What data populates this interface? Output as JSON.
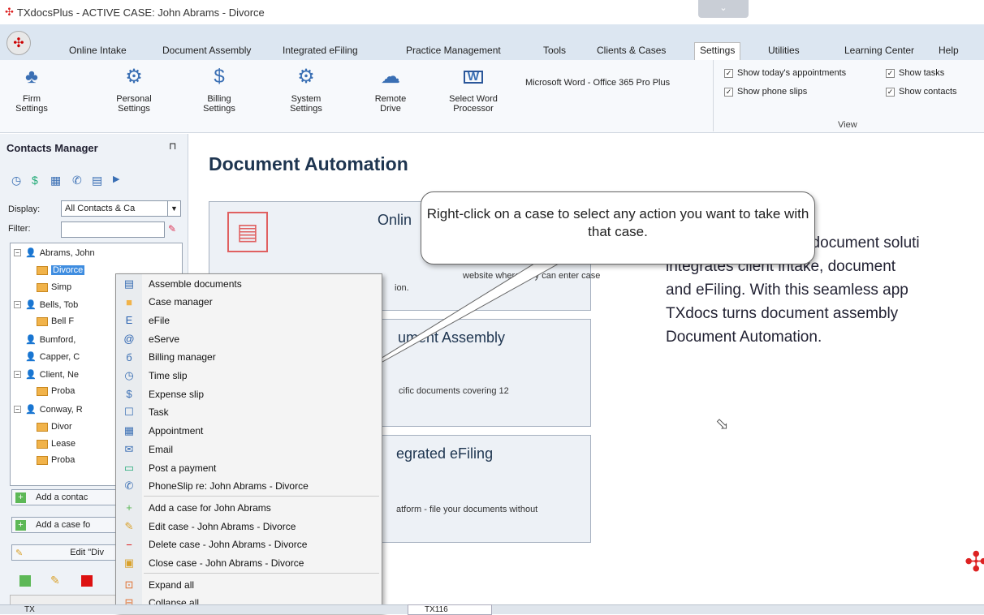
{
  "window": {
    "title": "TXdocsPlus - ACTIVE CASE: John Abrams - Divorce",
    "chevron": "⌄"
  },
  "tabs": [
    "Online Intake",
    "Document Assembly",
    "Integrated eFiling",
    "Practice Management",
    "Tools",
    "Clients & Cases",
    "Settings",
    "Utilities",
    "Learning Center",
    "Help"
  ],
  "ribbon": {
    "buttons": [
      {
        "l1": "Firm",
        "l2": "Settings",
        "icon": "firm-settings-icon"
      },
      {
        "l1": "Personal",
        "l2": "Settings",
        "icon": "person-gear-icon"
      },
      {
        "l1": "Billing",
        "l2": "Settings",
        "icon": "billing-icon"
      },
      {
        "l1": "System",
        "l2": "Settings",
        "icon": "gears-icon"
      },
      {
        "l1": "Remote",
        "l2": "Drive",
        "icon": "cloud-drive-icon"
      },
      {
        "l1": "Select Word",
        "l2": "Processor",
        "icon": "word-icon"
      }
    ],
    "word_version": "Microsoft Word - Office 365 Pro Plus",
    "view": {
      "label": "View",
      "checks": [
        "Show today's appointments",
        "Show tasks",
        "Show phone slips",
        "Show contacts"
      ]
    }
  },
  "contacts": {
    "title": "Contacts Manager",
    "pin": "⊓",
    "display_label": "Display:",
    "display_value": "All Contacts & Ca",
    "filter_label": "Filter:"
  },
  "tree": [
    {
      "t": "Abrams, John",
      "k": "p",
      "exp": "−"
    },
    {
      "t": "Divorce",
      "k": "c",
      "sel": true
    },
    {
      "t": "Simp",
      "k": "c"
    },
    {
      "t": "Bells, Tob",
      "k": "p",
      "exp": "−"
    },
    {
      "t": "Bell F",
      "k": "c"
    },
    {
      "t": "Bumford,",
      "k": "p"
    },
    {
      "t": "Capper, C",
      "k": "p"
    },
    {
      "t": "Client, Ne",
      "k": "p",
      "exp": "−"
    },
    {
      "t": "Proba",
      "k": "c"
    },
    {
      "t": "Conway, R",
      "k": "p",
      "exp": "−"
    },
    {
      "t": "Divor",
      "k": "c"
    },
    {
      "t": "Lease",
      "k": "c"
    },
    {
      "t": "Proba",
      "k": "c"
    }
  ],
  "left_buttons": {
    "add_contact": "Add a contac",
    "add_case": "Add a case fo",
    "edit": "Edit \"Div"
  },
  "main": {
    "title": "Document Automation",
    "cards": [
      {
        "title": "Onlin",
        "desc": "website where they can enter case",
        "desc2": "ion."
      },
      {
        "title": "ument Assembly",
        "desc": "cific documents covering 12"
      },
      {
        "title": "egrated eFiling",
        "desc": "atform - file your documents without"
      }
    ],
    "right_lines": [
      "t document soluti",
      "integrates client intake, document",
      "and eFiling. With this seamless app",
      "TXdocs turns document assembly",
      "Document Automation."
    ],
    "callout": "Right-click on a case to select any action you want to take with that case."
  },
  "menu": [
    {
      "label": "Assemble documents",
      "icon": "document-icon"
    },
    {
      "label": "Case manager",
      "icon": "briefcase-icon"
    },
    {
      "label": "eFile",
      "icon": "efile-icon"
    },
    {
      "label": "eServe",
      "icon": "at-sign-icon"
    },
    {
      "label": "Billing manager",
      "icon": "billing-manager-icon"
    },
    {
      "label": "Time slip",
      "icon": "clock-icon"
    },
    {
      "label": "Expense slip",
      "icon": "coin-icon"
    },
    {
      "label": "Task",
      "icon": "task-icon"
    },
    {
      "label": "Appointment",
      "icon": "calendar-icon"
    },
    {
      "label": "Email",
      "icon": "email-icon"
    },
    {
      "label": "Post a payment",
      "icon": "payment-icon"
    },
    {
      "label": "PhoneSlip re: John Abrams - Divorce",
      "icon": "phone-icon"
    },
    {
      "label": "Add a case for John Abrams",
      "icon": "plus-icon",
      "sep": true
    },
    {
      "label": "Edit case - John Abrams - Divorce",
      "icon": "edit-icon"
    },
    {
      "label": "Delete case - John Abrams - Divorce",
      "icon": "minus-icon"
    },
    {
      "label": "Close case - John Abrams - Divorce",
      "icon": "close-case-icon"
    },
    {
      "label": "Expand all",
      "icon": "expand-icon",
      "sep": true
    },
    {
      "label": "Collapse all",
      "icon": "collapse-icon"
    }
  ],
  "status": {
    "left": "TX",
    "tab": "TX116"
  }
}
